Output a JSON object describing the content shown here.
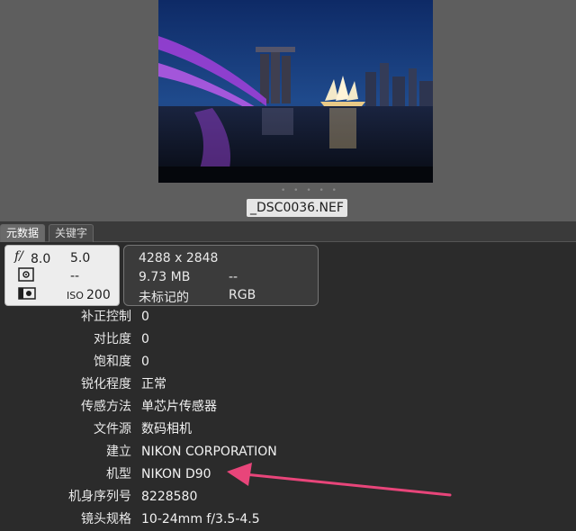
{
  "preview": {
    "filename": "_DSC0036.NEF",
    "dots": "• • • • •"
  },
  "tabs": [
    {
      "label": "元数据",
      "active": true
    },
    {
      "label": "关键字",
      "active": false
    }
  ],
  "exposure": {
    "aperture": "8.0",
    "aperture_prefix": "f/",
    "shutter": "5.0",
    "exposure_comp": "--",
    "iso_label": "ISO",
    "iso": "200"
  },
  "info": {
    "dimensions": "4288 x 2848",
    "filesize": "9.73 MB",
    "filesize_extra": "--",
    "label": "未标记的",
    "colorspace": "RGB"
  },
  "metadata": [
    {
      "key": "补正控制",
      "value": "0"
    },
    {
      "key": "对比度",
      "value": "0"
    },
    {
      "key": "饱和度",
      "value": "0"
    },
    {
      "key": "锐化程度",
      "value": "正常"
    },
    {
      "key": "传感方法",
      "value": "单芯片传感器"
    },
    {
      "key": "文件源",
      "value": "数码相机"
    },
    {
      "key": "建立",
      "value": "NIKON CORPORATION"
    },
    {
      "key": "机型",
      "value": "NIKON D90"
    },
    {
      "key": "机身序列号",
      "value": "8228580"
    },
    {
      "key": "镜头规格",
      "value": "10-24mm f/3.5-4.5"
    }
  ],
  "colors": {
    "arrow": "#e8457a",
    "top_bg": "#5e5e5e",
    "panel_bg": "#2b2b2b"
  }
}
